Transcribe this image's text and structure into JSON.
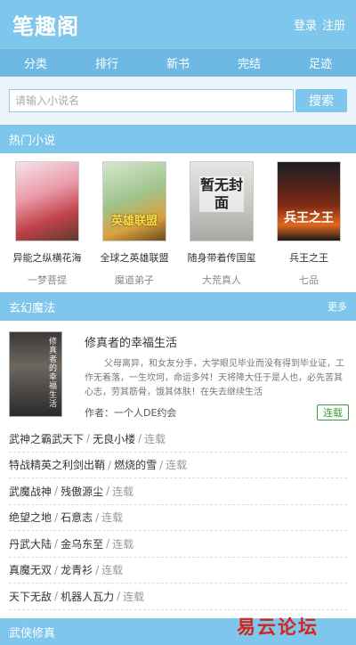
{
  "header": {
    "logo": "笔趣阁",
    "login": "登录",
    "register": "注册"
  },
  "nav": [
    "分类",
    "排行",
    "新书",
    "完结",
    "足迹"
  ],
  "search": {
    "placeholder": "请输入小说名",
    "button": "搜索"
  },
  "hot": {
    "title": "热门小说",
    "items": [
      {
        "title": "异能之纵横花海",
        "author": "一梦菩提",
        "cover_text": ""
      },
      {
        "title": "全球之英雄联盟",
        "author": "魔道弟子",
        "cover_text": "英雄联盟"
      },
      {
        "title": "随身带着传国玺",
        "author": "大荒真人",
        "cover_text": "暂无封面"
      },
      {
        "title": "兵王之王",
        "author": "七品",
        "cover_text": "兵王之王"
      }
    ]
  },
  "fantasy": {
    "title": "玄幻魔法",
    "more": "更多",
    "feature": {
      "title": "修真者的幸福生活",
      "description": "父母离异，和女友分手，大学眼见毕业而没有得到毕业证，工作无着落，一生坎坷，命运多舛！天将降大任于是人也，必先苦其心志，劳其筋骨，饿其体肤！在失去继续生活",
      "author": "作者：一个人DE约会",
      "status": "连载",
      "cover_text": "修真者的幸福生活"
    },
    "list": [
      {
        "title": "武神之霸武天下",
        "author": "无良小楼",
        "status": "连载"
      },
      {
        "title": "特战精英之利剑出鞘",
        "author": "燃烧的雪",
        "status": "连载"
      },
      {
        "title": "武魔战神",
        "author": "残傲源尘",
        "status": "连载"
      },
      {
        "title": "绝望之地",
        "author": "石意志",
        "status": "连载"
      },
      {
        "title": "丹武大陆",
        "author": "金乌东至",
        "status": "连载"
      },
      {
        "title": "真魔无双",
        "author": "龙青衫",
        "status": "连载"
      },
      {
        "title": "天下无敌",
        "author": "机器人瓦力",
        "status": "连载"
      }
    ]
  },
  "wuxia": {
    "title": "武侠修真"
  },
  "watermark": "易云论坛"
}
